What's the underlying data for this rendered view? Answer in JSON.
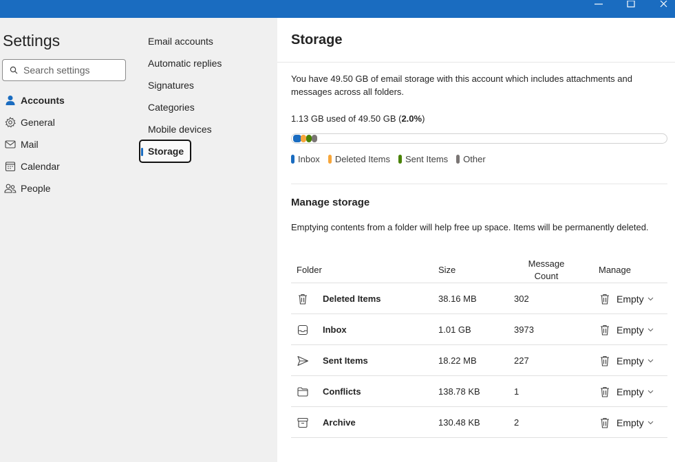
{
  "window": {
    "controls": [
      "minimize-icon",
      "maximize-icon",
      "close-icon"
    ],
    "accent_color": "#1a6cc0"
  },
  "settings": {
    "title": "Settings",
    "search_placeholder": "Search settings",
    "nav": [
      {
        "label": "Accounts",
        "icon": "person-icon",
        "active": true
      },
      {
        "label": "General",
        "icon": "gear-icon",
        "active": false
      },
      {
        "label": "Mail",
        "icon": "mail-icon",
        "active": false
      },
      {
        "label": "Calendar",
        "icon": "calendar-icon",
        "active": false
      },
      {
        "label": "People",
        "icon": "people-icon",
        "active": false
      }
    ]
  },
  "accounts_menu": {
    "items": [
      "Email accounts",
      "Automatic replies",
      "Signatures",
      "Categories",
      "Mobile devices",
      "Storage"
    ],
    "selected": "Storage"
  },
  "storage": {
    "title": "Storage",
    "description": "You have 49.50 GB of email storage with this account which includes attachments and messages across all folders.",
    "usage_prefix": "1.13 GB used of 49.50 GB (",
    "usage_percent": "2.0%",
    "usage_suffix": ")",
    "usage_fraction": 0.02,
    "legend": [
      {
        "label": "Inbox",
        "color": "#1a6cc0"
      },
      {
        "label": "Deleted Items",
        "color": "#f7a63a"
      },
      {
        "label": "Sent Items",
        "color": "#498205"
      },
      {
        "label": "Other",
        "color": "#7a7574"
      }
    ]
  },
  "manage": {
    "title": "Manage storage",
    "description": "Emptying contents from a folder will help free up space. Items will be permanently deleted.",
    "columns": {
      "folder": "Folder",
      "size": "Size",
      "count_line1": "Message",
      "count_line2": "Count",
      "manage": "Manage"
    },
    "empty_label": "Empty",
    "rows": [
      {
        "name": "Deleted Items",
        "icon": "trash-icon",
        "size": "38.16 MB",
        "count": "302"
      },
      {
        "name": "Inbox",
        "icon": "inbox-icon",
        "size": "1.01 GB",
        "count": "3973"
      },
      {
        "name": "Sent Items",
        "icon": "send-icon",
        "size": "18.22 MB",
        "count": "227"
      },
      {
        "name": "Conflicts",
        "icon": "folder-icon",
        "size": "138.78 KB",
        "count": "1"
      },
      {
        "name": "Archive",
        "icon": "archive-icon",
        "size": "130.48 KB",
        "count": "2"
      }
    ]
  }
}
